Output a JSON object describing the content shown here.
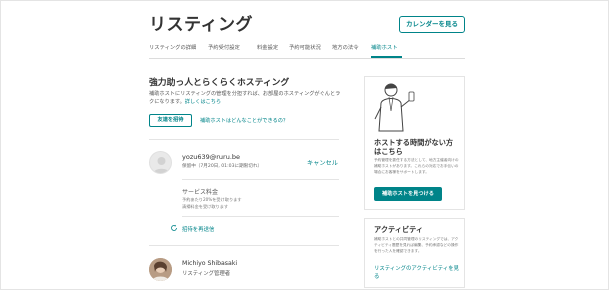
{
  "header": {
    "title": "リスティング",
    "calendar_button": "カレンダーを見る"
  },
  "tabs": [
    {
      "label": "リスティングの詳細"
    },
    {
      "label": "予約受付設定"
    },
    {
      "label": "料金設定"
    },
    {
      "label": "予約可能状況"
    },
    {
      "label": "地方の法令"
    },
    {
      "label": "補助ホスト"
    }
  ],
  "active_tab": "補助ホスト",
  "intro": {
    "heading": "強力助っ人とらくらくホスティング",
    "desc": "補助ホストにリスティングの管理を分担すれば、お部屋のホスティングがぐんとラクになります。",
    "desc_link": "詳しくはこちら",
    "invite_button": "友達を招待",
    "what_link": "補助ホストはどんなことができるの？"
  },
  "pending_invite": {
    "email": "yozu639@ruru.be",
    "status": "保留中（7月20日, 01:03に期限切れ）",
    "cancel": "キャンセル",
    "service_title": "サービス料金",
    "service_lines": [
      "予約あたり20%を受け取ります",
      "清掃料金を受け取ります"
    ],
    "resend": "招待を再送信"
  },
  "member": {
    "name": "Michiyo Shibasaki",
    "role": "リスティング管理者"
  },
  "sidebar_card": {
    "title": "ホストする時間がない方はこちら",
    "body": "予約管理を委任する方法として、地方主催者向けの補助ホストがあります。これらの対応でお手伝いの場合にお客様をサポートします。",
    "button": "補助ホストを見つける"
  },
  "activity_card": {
    "title": "アクティビティ",
    "body": "補助ホストとの共同管理のリスティングでは、アクティビティ履歴を見れば編集、予約承認などの操作を行った人を確認できます。",
    "link": "リスティングのアクティビティを見る"
  },
  "colors": {
    "accent": "#008489",
    "text": "#484848",
    "border": "#e4e4e4"
  }
}
